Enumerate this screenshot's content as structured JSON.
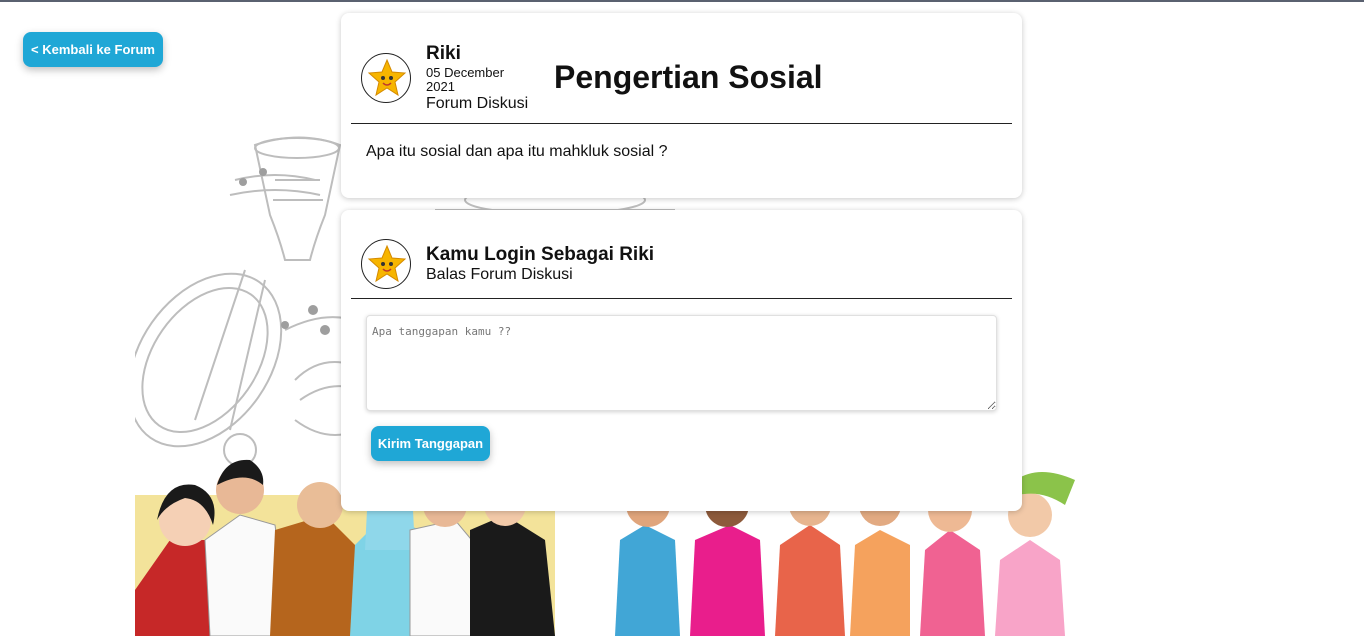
{
  "nav": {
    "back_label": "< Kembali ke Forum"
  },
  "post": {
    "author": "Riki",
    "date": "05 December 2021",
    "forum_label": "Forum Diskusi",
    "title": "Pengertian Sosial",
    "question": "Apa itu sosial dan apa itu mahkluk sosial ?"
  },
  "reply": {
    "login_title": "Kamu Login Sebagai Riki",
    "reply_label": "Balas Forum Diskusi",
    "placeholder": "Apa tanggapan kamu ??",
    "send_label": "Kirim Tanggapan"
  },
  "icons": {
    "avatar": "star-mascot-icon"
  },
  "colors": {
    "accent": "#1fa7d6",
    "topbar": "#5a6170"
  }
}
